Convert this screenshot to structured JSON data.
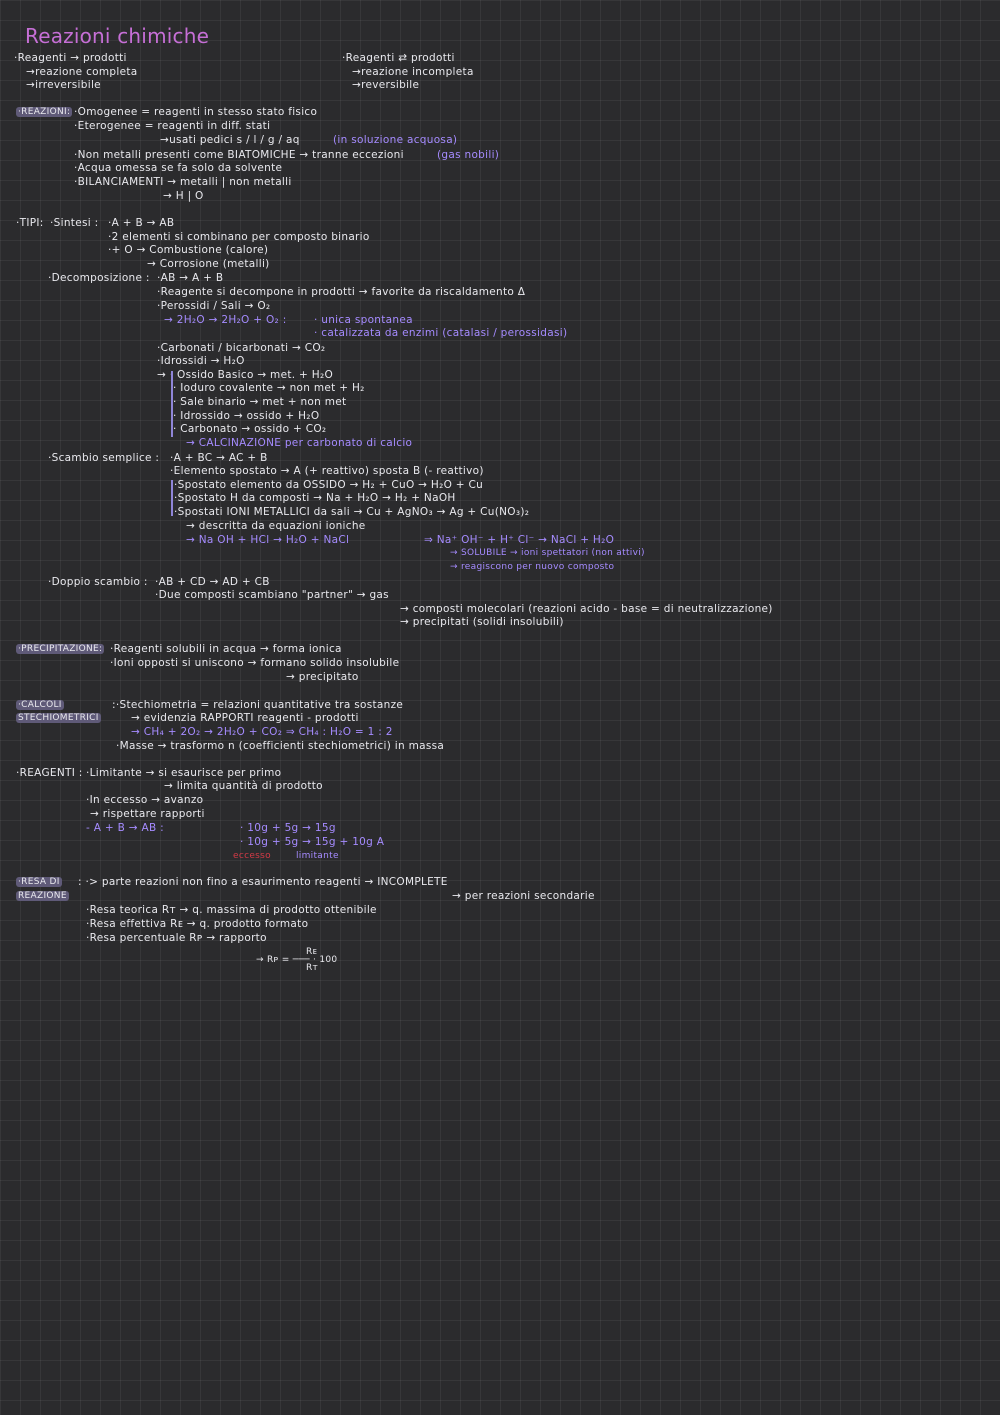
{
  "title": "Reazioni chimiche",
  "lines": [
    {
      "id": "l1",
      "text": "·Reagenti  →  prodotti"
    },
    {
      "id": "l2",
      "text": "→reazione completa"
    },
    {
      "id": "l3",
      "text": "→irreversibile"
    },
    {
      "id": "r1",
      "text": "·Reagenti ⇄ prodotti"
    },
    {
      "id": "r2",
      "text": "→reazione incompleta"
    },
    {
      "id": "r3",
      "text": "→reversibile"
    },
    {
      "id": "rz0",
      "text": "·REAZIONI:"
    },
    {
      "id": "rz1",
      "text": "·Omogenee = reagenti in stesso stato fisico"
    },
    {
      "id": "rz2",
      "text": "·Eterogenee = reagenti in diff. stati"
    },
    {
      "id": "rz3",
      "text": "→usati pedici  s / l / g / aq"
    },
    {
      "id": "rz3b",
      "text": "(in soluzione acquosa)"
    },
    {
      "id": "rz4",
      "text": "·Non metalli presenti come BIATOMICHE → tranne eccezioni"
    },
    {
      "id": "rz4b",
      "text": "(gas nobili)"
    },
    {
      "id": "rz5",
      "text": "·Acqua omessa se fa solo da solvente"
    },
    {
      "id": "rz6",
      "text": "·BILANCIAMENTI → metalli | non metalli"
    },
    {
      "id": "rz7",
      "text": "→ H | O"
    },
    {
      "id": "tp0",
      "text": "·TIPI:"
    },
    {
      "id": "tp1",
      "text": "·Sintesi :"
    },
    {
      "id": "tp2",
      "text": "·A + B  →  AB"
    },
    {
      "id": "tp3",
      "text": "·2 elementi si combinano per composto binario"
    },
    {
      "id": "tp4",
      "text": "·+ O  → Combustione  (calore)"
    },
    {
      "id": "tp5",
      "text": "→ Corrosione  (metalli)"
    },
    {
      "id": "dc0",
      "text": "·Decomposizione :"
    },
    {
      "id": "dc1",
      "text": "·AB  →  A + B"
    },
    {
      "id": "dc2",
      "text": "·Reagente si decompone in prodotti → favorite da riscaldamento  Δ"
    },
    {
      "id": "dc3",
      "text": "·Perossidi / Sali → O₂"
    },
    {
      "id": "dc4",
      "text": "→ 2H₂O  →  2H₂O + O₂ :"
    },
    {
      "id": "dc4b",
      "text": "· unica spontanea"
    },
    {
      "id": "dc4c",
      "text": "· catalizzata da enzimi  (catalasi / perossidasi)"
    },
    {
      "id": "dc5",
      "text": "·Carbonati / bicarbonati → CO₂"
    },
    {
      "id": "dc6",
      "text": "·Idrossidi → H₂O"
    },
    {
      "id": "dc7",
      "text": "→ · Ossido Basico  →  met. + H₂O"
    },
    {
      "id": "dc8",
      "text": "· Ioduro covalente  →  non met + H₂"
    },
    {
      "id": "dc9",
      "text": "· Sale binario  →  met + non met"
    },
    {
      "id": "dc10",
      "text": "· Idrossido  →  ossido + H₂O"
    },
    {
      "id": "dc11",
      "text": "· Carbonato  →  ossido + CO₂"
    },
    {
      "id": "dc12",
      "text": "→ CALCINAZIONE per carbonato di calcio"
    },
    {
      "id": "ss0",
      "text": "·Scambio semplice :"
    },
    {
      "id": "ss1",
      "text": "·A + BC  →  AC + B"
    },
    {
      "id": "ss2",
      "text": "·Elemento spostato → A (+ reattivo) sposta B (- reattivo)"
    },
    {
      "id": "ss3",
      "text": "·Spostato elemento da OSSIDO → H₂ + CuO → H₂O + Cu"
    },
    {
      "id": "ss4",
      "text": "·Spostato H da composti → Na + H₂O → H₂ + NaOH"
    },
    {
      "id": "ss5",
      "text": "·Spostati IONI METALLICI da sali → Cu + AgNO₃ → Ag + Cu(NO₃)₂"
    },
    {
      "id": "ss6",
      "text": "→ descritta da equazioni ioniche"
    },
    {
      "id": "ss7",
      "text": "→ Na OH  + HCl  →  H₂O  + NaCl"
    },
    {
      "id": "ss7b",
      "text": "⇒  Na⁺ OH⁻  + H⁺ Cl⁻  →  NaCl  + H₂O"
    },
    {
      "id": "ss8",
      "text": "→ SOLUBILE → ioni spettatori (non attivi)"
    },
    {
      "id": "ss9",
      "text": "→ reagiscono per nuovo composto"
    },
    {
      "id": "ds0",
      "text": "·Doppio scambio :"
    },
    {
      "id": "ds1",
      "text": "·AB + CD  →  AD + CB"
    },
    {
      "id": "ds2",
      "text": "·Due composti scambiano \"partner\"  → gas"
    },
    {
      "id": "ds3",
      "text": "→ composti molecolari (reazioni acido - base = di neutralizzazione)"
    },
    {
      "id": "ds4",
      "text": "→ precipitati (solidi insolubili)"
    },
    {
      "id": "pr0",
      "text": "·PRECIPITAZIONE:"
    },
    {
      "id": "pr1",
      "text": "·Reagenti solubili in acqua → forma ionica"
    },
    {
      "id": "pr2",
      "text": "·Ioni opposti si uniscono → formano solido insolubile"
    },
    {
      "id": "pr3",
      "text": "→ precipitato"
    },
    {
      "id": "cs0",
      "text": "·CALCOLI"
    },
    {
      "id": "cs0b",
      "text": "STECHIOMETRICI"
    },
    {
      "id": "cs1",
      "text": ":·Stechiometria = relazioni quantitative tra sostanze"
    },
    {
      "id": "cs2",
      "text": "→ evidenzia RAPPORTI reagenti - prodotti"
    },
    {
      "id": "cs3",
      "text": "→ CH₄ + 2O₂  →  2H₂O + CO₂   ⇒   CH₄ : H₂O = 1 : 2"
    },
    {
      "id": "cs4",
      "text": "·Masse → trasformo n (coefficienti stechiometrici) in massa"
    },
    {
      "id": "rg0",
      "text": "·REAGENTI :"
    },
    {
      "id": "rg1",
      "text": "·Limitante → si esaurisce per primo"
    },
    {
      "id": "rg2",
      "text": "→ limita quantità di prodotto"
    },
    {
      "id": "rg3",
      "text": "·In eccesso → avanzo"
    },
    {
      "id": "rg4",
      "text": "→ rispettare rapporti"
    },
    {
      "id": "rg5",
      "text": "- A  +  B   →  AB  :"
    },
    {
      "id": "rg6",
      "text": "· 10g + 5g  →  15g"
    },
    {
      "id": "rg7",
      "text": "· 10g + 5g  →  15g   + 10g A"
    },
    {
      "id": "rg8a",
      "text": "eccesso"
    },
    {
      "id": "rg8b",
      "text": "limitante"
    },
    {
      "id": "rs0",
      "text": "·RESA DI"
    },
    {
      "id": "rs0b",
      "text": "REAZIONE"
    },
    {
      "id": "rs1",
      "text": ": ·> parte reazioni non fino a esaurimento reagenti → INCOMPLETE"
    },
    {
      "id": "rs2",
      "text": "→ per reazioni secondarie"
    },
    {
      "id": "rs3",
      "text": "·Resa teorica Rт → q. massima di prodotto ottenibile"
    },
    {
      "id": "rs4",
      "text": "·Resa effettiva Rᴇ → q. prodotto formato"
    },
    {
      "id": "rs5",
      "text": "·Resa percentuale Rᴘ → rapporto"
    },
    {
      "id": "rs6",
      "text": "Rᴇ"
    },
    {
      "id": "rs7",
      "text": "→ Rᴘ =  ─── · 100"
    },
    {
      "id": "rs8",
      "text": "Rт"
    }
  ],
  "colors": {
    "accent": "#c66fd6",
    "blue": "#a58bff",
    "red": "#d23a46",
    "text": "#e9e9ee",
    "background": "#2b2b2d"
  }
}
